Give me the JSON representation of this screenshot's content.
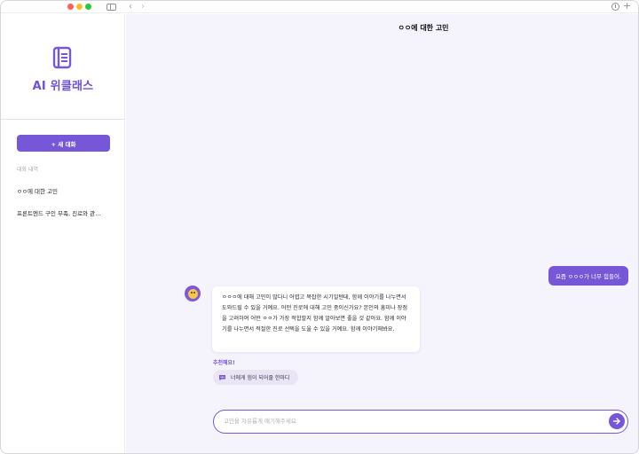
{
  "sidebar": {
    "logo_text": "AI 위클래스",
    "new_chat_label": "+ 새 대화",
    "history_label": "대화 내역",
    "history": [
      "ㅇㅇ에 대한 고민",
      "프론트엔드 구인 부족, 진로와 관…"
    ]
  },
  "chat": {
    "title": "ㅇㅇ에 대한 고민",
    "user_message": "요즘 ㅇㅇㅇ가 너무 힘들어.",
    "bot_message": "ㅇㅇㅇ에 대해 고민이 많다니 어렵고 복잡한 시기일텐데, 함께 이야기를 나누면서 도와드릴 수 있을 거예요. 어떤 진로에 대해 고민 중이신가요? 본인의 흥미나 장점을 고려하여 어떤 ㅇㅇ가 가장 적합할지 함께 알아보면 좋을 것 같아요. 함께 이야기를 나누면서 적절한 진로 선택을 도울 수 있을 거예요. 함께 이야기해봐요.",
    "recommend_label": "추천해요!",
    "recommend_chip": "너에게 힘이 되어줄 한마디",
    "input_placeholder": "고민을 자유롭게 얘기해주세요"
  },
  "icons": {
    "logo": "book-icon",
    "send": "arrow-right-icon",
    "chip": "chat-bubble-icon",
    "avatar": "smiling-face-icon"
  },
  "colors": {
    "accent": "#7657d8",
    "main_bg": "#f5f3fc"
  }
}
